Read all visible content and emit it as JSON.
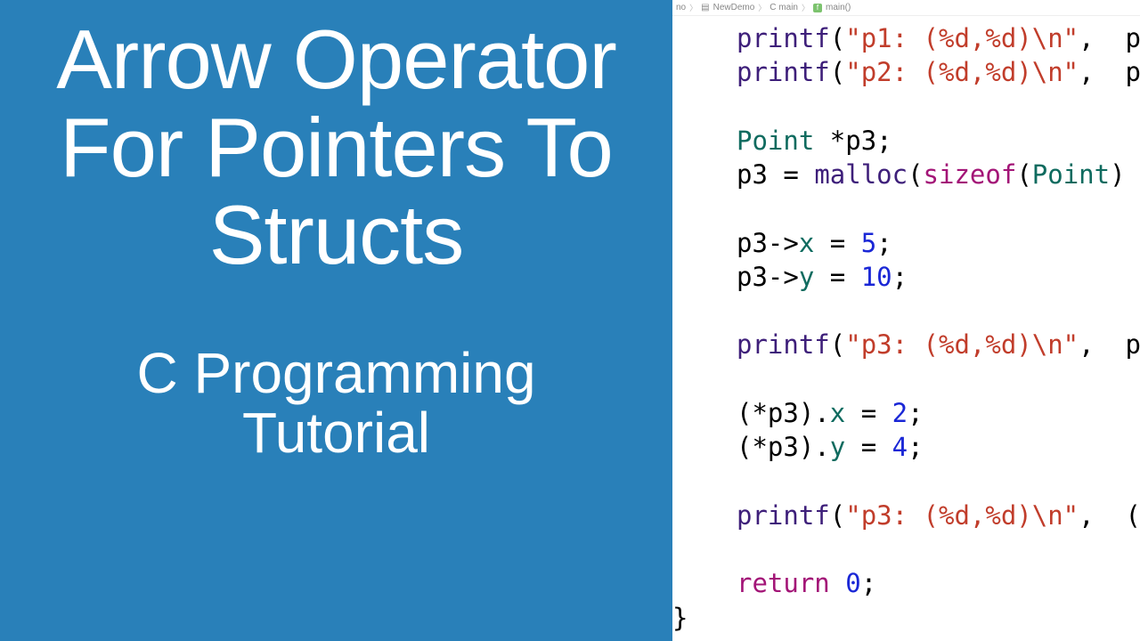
{
  "left": {
    "title_lines": [
      "Arrow Operator",
      "For Pointers To",
      "Structs"
    ],
    "subtitle_lines": [
      "C Programming",
      "Tutorial"
    ]
  },
  "breadcrumb": {
    "part0": "no",
    "part1": "NewDemo",
    "part2": "C  main",
    "part3": "main()"
  },
  "code": {
    "l1_printf": "printf",
    "l1_str": "\"p1: (%d,%d)\\n\"",
    "l1_tail": ",  p",
    "l2_printf": "printf",
    "l2_str": "\"p2: (%d,%d)\\n\"",
    "l2_tail": ",  p",
    "l4_type": "Point",
    "l4_rest": " *p3;",
    "l5_a": "p3 = ",
    "l5_malloc": "malloc",
    "l5_open": "(",
    "l5_sizeof": "sizeof",
    "l5_open2": "(",
    "l5_type": "Point",
    "l5_close": ")",
    "l7_a": "p3->",
    "l7_mem": "x",
    "l7_b": " = ",
    "l7_num": "5",
    "l7_c": ";",
    "l8_a": "p3->",
    "l8_mem": "y",
    "l8_b": " = ",
    "l8_num": "10",
    "l8_c": ";",
    "l10_printf": "printf",
    "l10_str": "\"p3: (%d,%d)\\n\"",
    "l10_tail": ",  p",
    "l12_a": "(*p3).",
    "l12_mem": "x",
    "l12_b": " = ",
    "l12_num": "2",
    "l12_c": ";",
    "l13_a": "(*p3).",
    "l13_mem": "y",
    "l13_b": " = ",
    "l13_num": "4",
    "l13_c": ";",
    "l15_printf": "printf",
    "l15_str": "\"p3: (%d,%d)\\n\"",
    "l15_tail": ",  (",
    "l17_return": "return",
    "l17_b": " ",
    "l17_num": "0",
    "l17_c": ";",
    "l18_brace": "}"
  }
}
